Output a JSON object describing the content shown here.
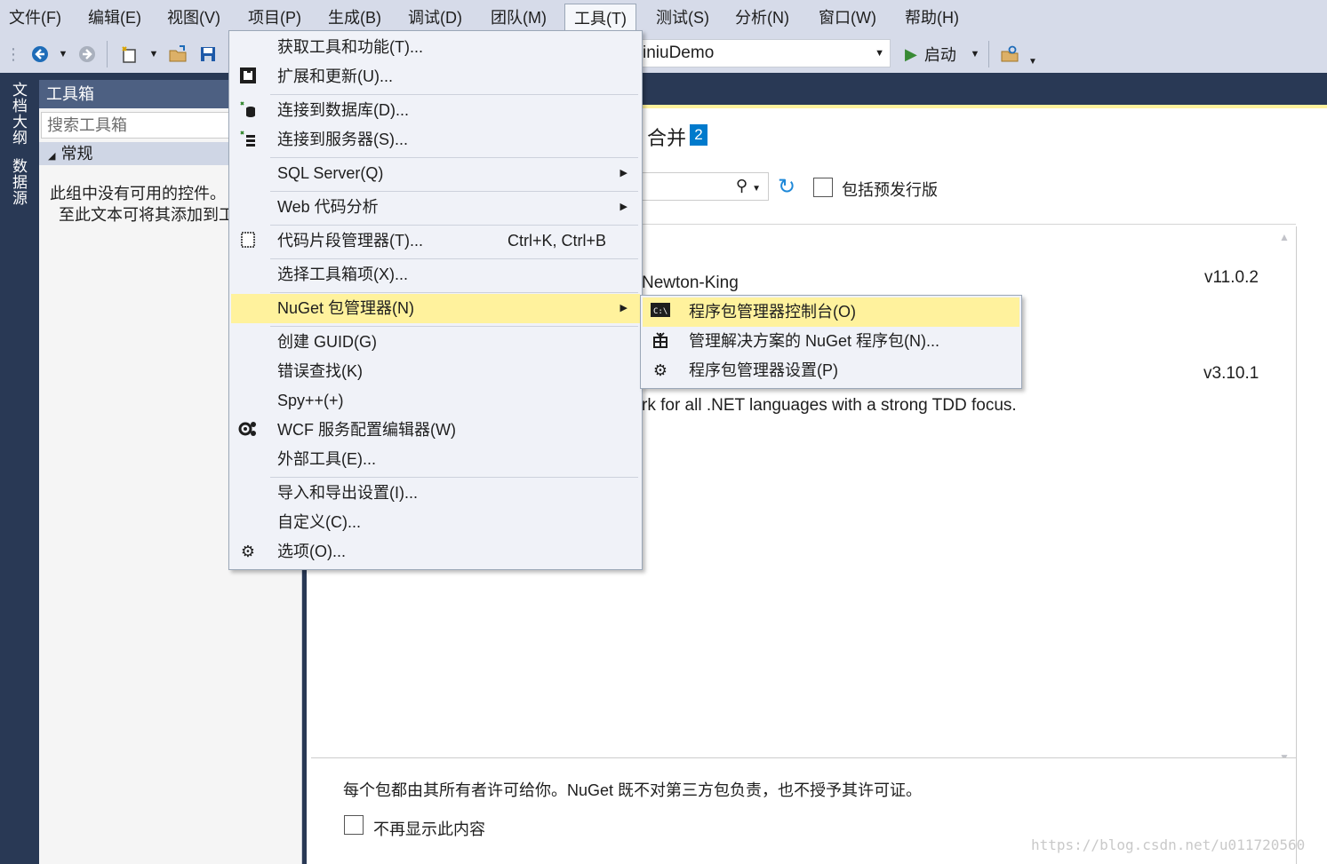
{
  "menubar": {
    "items": [
      "文件(F)",
      "编辑(E)",
      "视图(V)",
      "项目(P)",
      "生成(B)",
      "调试(D)",
      "团队(M)",
      "工具(T)",
      "测试(S)",
      "分析(N)",
      "窗口(W)",
      "帮助(H)"
    ]
  },
  "toolbar": {
    "project_combo": "iniuDemo",
    "start_label": "启动"
  },
  "left_tabs": [
    "文档大纲",
    "数据源"
  ],
  "toolbox": {
    "title": "工具箱",
    "search_placeholder": "搜索工具箱",
    "group": "常规",
    "empty_line1": "此组中没有可用的控件。",
    "empty_line2": "至此文本可将其添加到工"
  },
  "nuget": {
    "merge_title": "合并",
    "merge_count": "2",
    "prerelease_label": "包括预发行版",
    "pkg1_author": "Newton-King",
    "pkg1_version": "v11.0.2",
    "pkg2_version": "v3.10.1",
    "pkg2_desc": "rk for all .NET languages with a strong TDD focus.",
    "license_text": "每个包都由其所有者许可给你。NuGet 既不对第三方包负责，也不授予其许可证。",
    "dont_show_label": "不再显示此内容"
  },
  "tools_menu": {
    "items": [
      {
        "label": "获取工具和功能(T)...",
        "icon": "",
        "shortcut": "",
        "submenu": false
      },
      {
        "label": "扩展和更新(U)...",
        "icon": "extensions-icon",
        "shortcut": "",
        "submenu": false
      },
      {
        "label": "连接到数据库(D)...",
        "icon": "database-icon",
        "shortcut": "",
        "submenu": false
      },
      {
        "label": "连接到服务器(S)...",
        "icon": "server-icon",
        "shortcut": "",
        "submenu": false
      },
      {
        "label": "SQL Server(Q)",
        "icon": "",
        "shortcut": "",
        "submenu": true
      },
      {
        "label": "Web 代码分析",
        "icon": "",
        "shortcut": "",
        "submenu": true
      },
      {
        "label": "代码片段管理器(T)...",
        "icon": "snippet-icon",
        "shortcut": "Ctrl+K, Ctrl+B",
        "submenu": false
      },
      {
        "label": "选择工具箱项(X)...",
        "icon": "",
        "shortcut": "",
        "submenu": false
      },
      {
        "label": "NuGet 包管理器(N)",
        "icon": "",
        "shortcut": "",
        "submenu": true
      },
      {
        "label": "创建 GUID(G)",
        "icon": "",
        "shortcut": "",
        "submenu": false
      },
      {
        "label": "错误查找(K)",
        "icon": "",
        "shortcut": "",
        "submenu": false
      },
      {
        "label": "Spy++(+)",
        "icon": "",
        "shortcut": "",
        "submenu": false
      },
      {
        "label": "WCF 服务配置编辑器(W)",
        "icon": "wcf-config-icon",
        "shortcut": "",
        "submenu": false
      },
      {
        "label": "外部工具(E)...",
        "icon": "",
        "shortcut": "",
        "submenu": false
      },
      {
        "label": "导入和导出设置(I)...",
        "icon": "",
        "shortcut": "",
        "submenu": false
      },
      {
        "label": "自定义(C)...",
        "icon": "",
        "shortcut": "",
        "submenu": false
      },
      {
        "label": "选项(O)...",
        "icon": "gear-icon",
        "shortcut": "",
        "submenu": false
      }
    ]
  },
  "nuget_submenu": {
    "items": [
      {
        "label": "程序包管理器控制台(O)",
        "icon": "console-icon"
      },
      {
        "label": "管理解决方案的 NuGet 程序包(N)...",
        "icon": "package-icon"
      },
      {
        "label": "程序包管理器设置(P)",
        "icon": "gear-icon"
      }
    ]
  },
  "watermark": "https://blog.csdn.net/u011720560",
  "colors": {
    "highlight": "#fff29d",
    "chrome": "#d6dbe9",
    "dark": "#293955",
    "accent": "#007acc"
  }
}
